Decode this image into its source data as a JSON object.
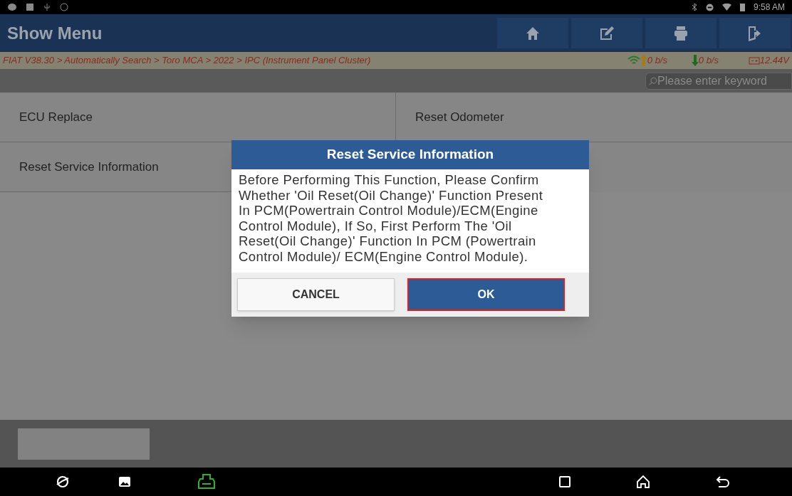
{
  "status_bar": {
    "time": "9:58 AM"
  },
  "header": {
    "title": "Show Menu",
    "toolbar": [
      {
        "kind": "home"
      },
      {
        "kind": "edit"
      },
      {
        "kind": "print"
      },
      {
        "kind": "exit"
      }
    ]
  },
  "breadcrumb": "FIAT V38.30 > Automatically Search > Toro MCA > 2022 > IPC (Instrument Panel Cluster)",
  "network": {
    "upload": "0 b/s",
    "download": "0 b/s",
    "voltage": "12.44V"
  },
  "search": {
    "placeholder": "Please enter keyword"
  },
  "menu_items": [
    "ECU Replace",
    "Reset Odometer",
    "Reset Service Information"
  ],
  "dialog": {
    "title": "Reset Service Information",
    "message": "Before Performing This Function, Please Confirm Whether 'Oil Reset(Oil Change)' Function Present In PCM(Powertrain Control Module)/ECM(Engine Control Module), If So, First Perform The 'Oil Reset(Oil Change)' Function In PCM (Powertrain Control Module)/ ECM(Engine Control Module).",
    "buttons": [
      {
        "label": "CANCEL",
        "kind": "secondary",
        "selected": false
      },
      {
        "label": "OK",
        "kind": "primary",
        "selected": true
      }
    ]
  }
}
